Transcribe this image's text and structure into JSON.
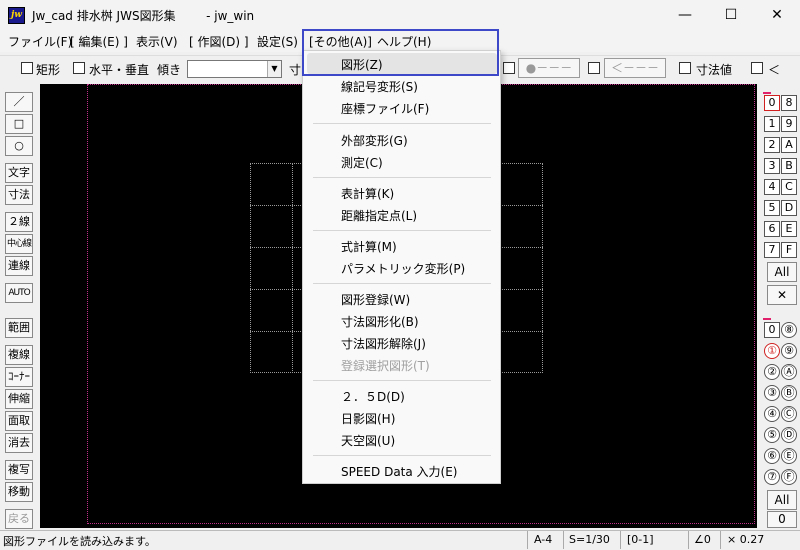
{
  "window": {
    "title": "Jw_cad 排水桝 JWS図形集        - jw_win",
    "icon_text": "jw",
    "minimize": "—",
    "maximize": "☐",
    "close": "✕"
  },
  "menubar": {
    "items": [
      "ファイル(F)",
      "[ 編集(E) ]",
      "表示(V)",
      "[ 作図(D) ]",
      "設定(S)",
      "[その他(A)]",
      "ヘルプ(H)"
    ]
  },
  "toolbar": {
    "rect_label": "矩形",
    "hv_label": "水平・垂直",
    "angle_label": "傾き",
    "angle_value": "",
    "dim_label": "寸",
    "line_style_1": "●－－－",
    "line_style_2": "＜－－－",
    "dim_value_label": "寸法値",
    "lt_label": "＜"
  },
  "left_tools": [
    "／",
    "□",
    "○",
    "文字",
    "寸法",
    "２線",
    "中心線",
    "連線",
    "AUTO",
    "範囲",
    "複線",
    "ｺｰﾅｰ",
    "伸縮",
    "面取",
    "消去",
    "複写",
    "移動",
    "戻る"
  ],
  "layer_groups": [
    "0",
    "8",
    "1",
    "9",
    "2",
    "A",
    "3",
    "B",
    "4",
    "C",
    "5",
    "D",
    "6",
    "E",
    "7",
    "F"
  ],
  "layers": [
    "0",
    "⑧",
    "①",
    "⑨",
    "②",
    "Ⓐ",
    "③",
    "Ⓑ",
    "④",
    "Ⓒ",
    "⑤",
    "Ⓓ",
    "⑥",
    "Ⓔ",
    "⑦",
    "Ⓕ"
  ],
  "right_buttons": {
    "all_top": "All",
    "x_top": "✕",
    "all_bottom": "All",
    "zero_bottom": "0"
  },
  "dropdown": {
    "groups": [
      [
        "図形(Z)",
        "線記号変形(S)",
        "座標ファイル(F)"
      ],
      [
        "外部変形(G)",
        "測定(C)"
      ],
      [
        "表計算(K)",
        "距離指定点(L)"
      ],
      [
        "式計算(M)",
        "パラメトリック変形(P)"
      ],
      [
        "図形登録(W)",
        "寸法図形化(B)",
        "寸法図形解除(J)",
        "登録選択図形(T)"
      ],
      [
        "２．５D(D)",
        "日影図(H)",
        "天空図(U)"
      ],
      [
        "SPEED Data 入力(E)"
      ]
    ]
  },
  "status": {
    "message": "図形ファイルを読み込みます。",
    "paper": "A-4",
    "scale": "S=1/30",
    "layer": "[0-1]",
    "angle": "∠0",
    "zoom": "× 0.27"
  }
}
